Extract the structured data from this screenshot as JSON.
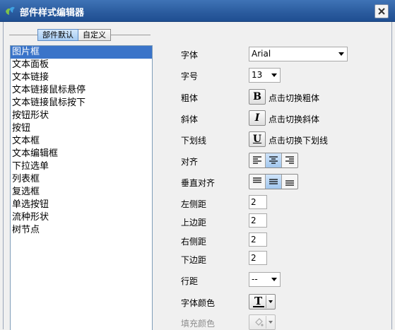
{
  "window": {
    "title": "部件样式编辑器",
    "close_icon": "close-icon",
    "app_icon": "app-logo-icon"
  },
  "tabs": [
    {
      "label": "部件默认",
      "active": true
    },
    {
      "label": "自定义",
      "active": false
    }
  ],
  "components": [
    "图片框",
    "文本面板",
    "文本链接",
    "文本链接鼠标悬停",
    "文本链接鼠标按下",
    "按钮形状",
    "按钮",
    "文本框",
    "文本编辑框",
    "下拉选单",
    "列表框",
    "复选框",
    "单选按钮",
    "流种形状",
    "树节点"
  ],
  "selected_component": "图片框",
  "properties": {
    "font": {
      "label": "字体",
      "value": "Arial"
    },
    "font_size": {
      "label": "字号",
      "value": "13"
    },
    "bold": {
      "label": "粗体",
      "button": "B",
      "hint": "点击切换粗体"
    },
    "italic": {
      "label": "斜体",
      "button": "I",
      "hint": "点击切换斜体"
    },
    "underline": {
      "label": "下划线",
      "button": "U",
      "hint": "点击切换下划线"
    },
    "align": {
      "label": "对齐",
      "options": [
        "left",
        "center",
        "right"
      ],
      "selected": "center"
    },
    "valign": {
      "label": "垂直对齐",
      "options": [
        "top",
        "middle",
        "bottom"
      ],
      "selected": "middle"
    },
    "padding_left": {
      "label": "左侧距",
      "value": "2"
    },
    "padding_top": {
      "label": "上边距",
      "value": "2"
    },
    "padding_right": {
      "label": "右侧距",
      "value": "2"
    },
    "padding_bottom": {
      "label": "下边距",
      "value": "2"
    },
    "line_spacing": {
      "label": "行距",
      "value": "--"
    },
    "font_color": {
      "label": "字体颜色",
      "glyph": "T",
      "color": "#000000"
    },
    "fill_color": {
      "label": "填充颜色",
      "enabled": false
    }
  },
  "colors": {
    "titlebar": "#2a5b9e",
    "selection": "#3a74c9",
    "toggle_on": "#a6cbf2"
  }
}
